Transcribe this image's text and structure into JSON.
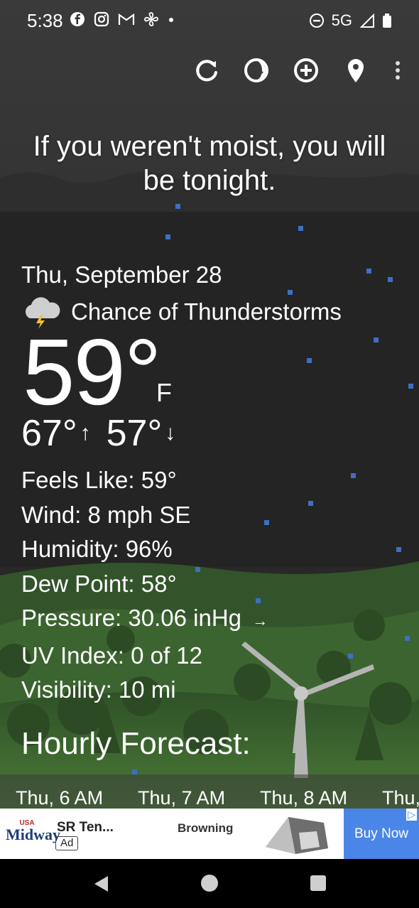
{
  "status_bar": {
    "time": "5:38",
    "network": "5G",
    "icons_left": [
      "facebook-icon",
      "instagram-icon",
      "gmail-icon",
      "fan-icon",
      "dot-icon"
    ],
    "icons_right": [
      "dnd-icon",
      "signal-icon",
      "battery-icon"
    ]
  },
  "toolbar": {
    "buttons": [
      "refresh-icon",
      "theme-icon",
      "add-icon",
      "location-icon",
      "more-icon"
    ]
  },
  "quote": "If you weren't moist, you will be tonight.",
  "current": {
    "date": "Thu, September 28",
    "condition": "Chance of Thunderstorms",
    "temperature": "59°",
    "unit": "F",
    "high": "67°",
    "low": "57°"
  },
  "details": [
    "Feels Like:  59°",
    "Wind:  8 mph SE",
    "Humidity:  96%",
    "Dew Point:  58°",
    "Pressure:  30.06 inHg",
    "UV Index:  0 of 12",
    "Visibility:  10 mi"
  ],
  "pressure_trend": "→",
  "hourly": {
    "title": "Hourly Forecast:",
    "labels": [
      "Thu, 6 AM",
      "Thu, 7 AM",
      "Thu, 8 AM",
      "Thu,"
    ]
  },
  "ad": {
    "logo_top": "USA",
    "logo_main": "Midway",
    "title": "SR Ten...",
    "badge": "Ad",
    "brand": "Browning",
    "cta": "Buy Now",
    "choices": "▷"
  },
  "colors": {
    "sky_top": "#3a3a3a",
    "sky_bottom": "#232323",
    "hills": "#3d6a30",
    "rain": "#3d6fc4",
    "ad_cta": "#4a86e8"
  }
}
